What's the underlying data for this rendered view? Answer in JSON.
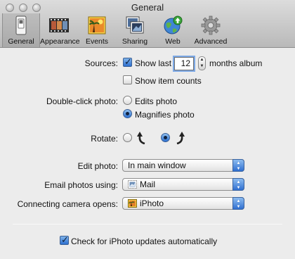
{
  "window": {
    "title": "General"
  },
  "toolbar": {
    "items": [
      {
        "label": "General",
        "icon": "switch-icon",
        "selected": true
      },
      {
        "label": "Appearance",
        "icon": "film-strip-icon"
      },
      {
        "label": "Events",
        "icon": "events-photo-icon"
      },
      {
        "label": "Sharing",
        "icon": "sharing-photos-icon"
      },
      {
        "label": "Web",
        "icon": "globe-upload-icon"
      },
      {
        "label": "Advanced",
        "icon": "gear-icon"
      }
    ]
  },
  "sources": {
    "label": "Sources:",
    "show_last_label": "Show last",
    "show_last_checked": true,
    "months_value": "12",
    "months_suffix": "months album",
    "show_item_counts_label": "Show item counts",
    "show_item_counts_checked": false
  },
  "double_click": {
    "label": "Double-click photo:",
    "options": [
      "Edits photo",
      "Magnifies photo"
    ],
    "selected": "Magnifies photo"
  },
  "rotate": {
    "label": "Rotate:",
    "options": [
      "rotate-counterclockwise-icon",
      "rotate-clockwise-icon"
    ],
    "selected": "rotate-clockwise-icon"
  },
  "edit_photo": {
    "label": "Edit photo:",
    "value": "In main window"
  },
  "email_photos": {
    "label": "Email photos using:",
    "value": "Mail",
    "icon": "mail-stamp-icon"
  },
  "camera_opens": {
    "label": "Connecting camera opens:",
    "value": "iPhoto",
    "icon": "iphoto-icon"
  },
  "updates": {
    "label": "Check for iPhoto updates automatically",
    "checked": true
  },
  "colors": {
    "accent": "#2d6fcf",
    "window_bg": "#ececec",
    "toolbar_bg": "#c4c4c4"
  }
}
